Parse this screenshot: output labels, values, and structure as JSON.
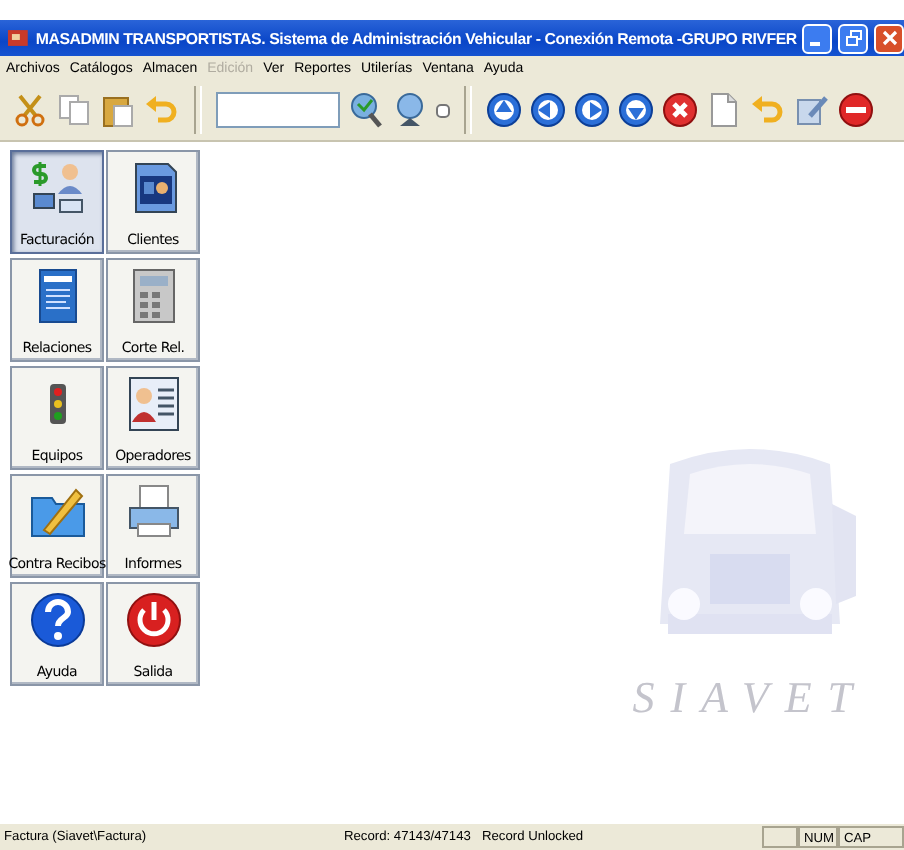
{
  "window": {
    "title": "MASADMIN TRANSPORTISTAS. Sistema de Administración Vehicular - Conexión Remota -GRUPO RIVFER"
  },
  "menu": [
    {
      "label": "Archivos",
      "disabled": false
    },
    {
      "label": "Catálogos",
      "disabled": false
    },
    {
      "label": "Almacen",
      "disabled": false
    },
    {
      "label": "Edición",
      "disabled": true
    },
    {
      "label": "Ver",
      "disabled": false
    },
    {
      "label": "Reportes",
      "disabled": false
    },
    {
      "label": "Utilerías",
      "disabled": false
    },
    {
      "label": "Ventana",
      "disabled": false
    },
    {
      "label": "Ayuda",
      "disabled": false
    }
  ],
  "toolbar": [
    {
      "kind": "cut"
    },
    {
      "kind": "copy"
    },
    {
      "kind": "paste"
    },
    {
      "kind": "undo"
    },
    {
      "kind": "separator"
    },
    {
      "kind": "field"
    },
    {
      "kind": "find"
    },
    {
      "kind": "search"
    },
    {
      "kind": "checkbox",
      "checked": false
    },
    {
      "kind": "separator"
    },
    {
      "kind": "up"
    },
    {
      "kind": "left"
    },
    {
      "kind": "right"
    },
    {
      "kind": "down"
    },
    {
      "kind": "delete"
    },
    {
      "kind": "new"
    },
    {
      "kind": "undo"
    },
    {
      "kind": "edit"
    },
    {
      "kind": "stop"
    }
  ],
  "launcher": [
    {
      "label": "Facturación",
      "kind": "billing",
      "selected": true
    },
    {
      "label": "Clientes",
      "kind": "card",
      "selected": false
    },
    {
      "label": "Relaciones",
      "kind": "document",
      "selected": false
    },
    {
      "label": "Corte Rel.",
      "kind": "calculator",
      "selected": false
    },
    {
      "label": "Equipos",
      "kind": "traffic",
      "selected": false
    },
    {
      "label": "Operadores",
      "kind": "list",
      "selected": false
    },
    {
      "label": "Contra Recibos",
      "kind": "folder",
      "selected": false
    },
    {
      "label": "Informes",
      "kind": "printer",
      "selected": false
    },
    {
      "label": "Ayuda",
      "kind": "help",
      "selected": false
    },
    {
      "label": "Salida",
      "kind": "power",
      "selected": false
    }
  ],
  "logo": {
    "text": "SIAVET"
  },
  "status_bar": {
    "panels": [
      "Factura (Siavet\\Factura)",
      "Record: 47143/47143",
      "Record Unlocked",
      "NUM",
      "CAP"
    ]
  }
}
